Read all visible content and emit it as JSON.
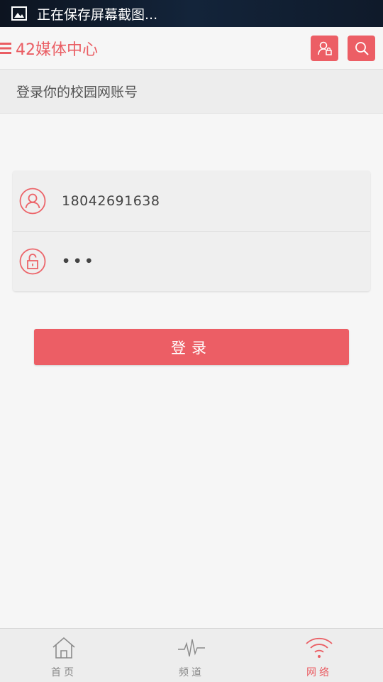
{
  "status_bar": {
    "notification": "正在保存屏幕截图..."
  },
  "app_bar": {
    "title": "42媒体中心"
  },
  "sub_header": {
    "title": "登录你的校园网账号"
  },
  "login": {
    "username": "18042691638",
    "password_masked": "•••",
    "submit_label": "登录"
  },
  "bottom_nav": [
    {
      "label": "首页",
      "icon": "home-icon",
      "active": false
    },
    {
      "label": "频道",
      "icon": "pulse-icon",
      "active": false
    },
    {
      "label": "网络",
      "icon": "wifi-icon",
      "active": true
    }
  ],
  "colors": {
    "accent": "#ec5e65",
    "background": "#f6f6f6",
    "nav_inactive": "#888888"
  }
}
